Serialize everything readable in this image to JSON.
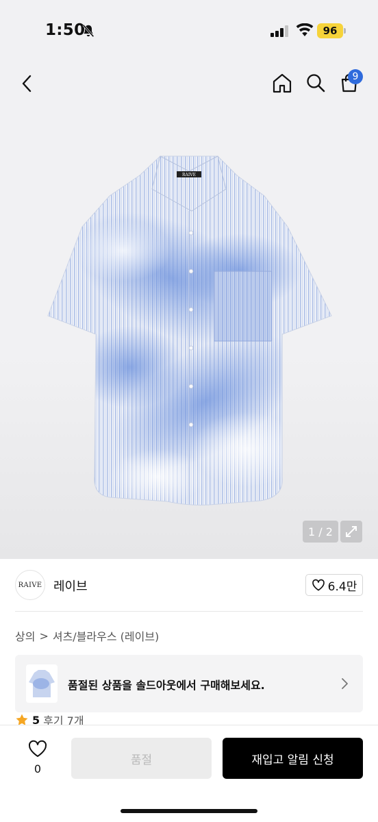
{
  "status_bar": {
    "time": "1:50",
    "battery": "96",
    "bell_icon": "bell-slash-icon",
    "signal_icon": "cellular-signal-icon",
    "wifi_icon": "wifi-icon",
    "battery_color": "#f6d33a"
  },
  "header": {
    "back_icon": "chevron-left-icon",
    "home_icon": "home-icon",
    "search_icon": "search-icon",
    "cart_icon": "shopping-bag-icon",
    "cart_count": "9",
    "badge_color": "#2f6bdc"
  },
  "gallery": {
    "pager": "1 / 2",
    "expand_icon": "expand-arrow-icon",
    "collar_label": "RAIVE"
  },
  "brand": {
    "logo_text": "RAIVE",
    "name": "레이브",
    "like_count": "6.4만",
    "like_icon": "heart-outline-icon"
  },
  "breadcrumb": {
    "category": "상의",
    "separator": ">",
    "subcategory": "셔츠/블라우스 (레이브)"
  },
  "soldout_banner": {
    "text": "품절된 상품을 솔드아웃에서 구매해보세요.",
    "chevron_icon": "chevron-right-icon"
  },
  "rating": {
    "star_icon": "star-filled-icon",
    "score": "5",
    "reviews": "후기 7개",
    "star_color": "#f5a623"
  },
  "bottom_bar": {
    "wish_icon": "heart-outline-icon",
    "wish_count": "0",
    "soldout_label": "품절",
    "restock_label": "재입고 알림 신청"
  }
}
